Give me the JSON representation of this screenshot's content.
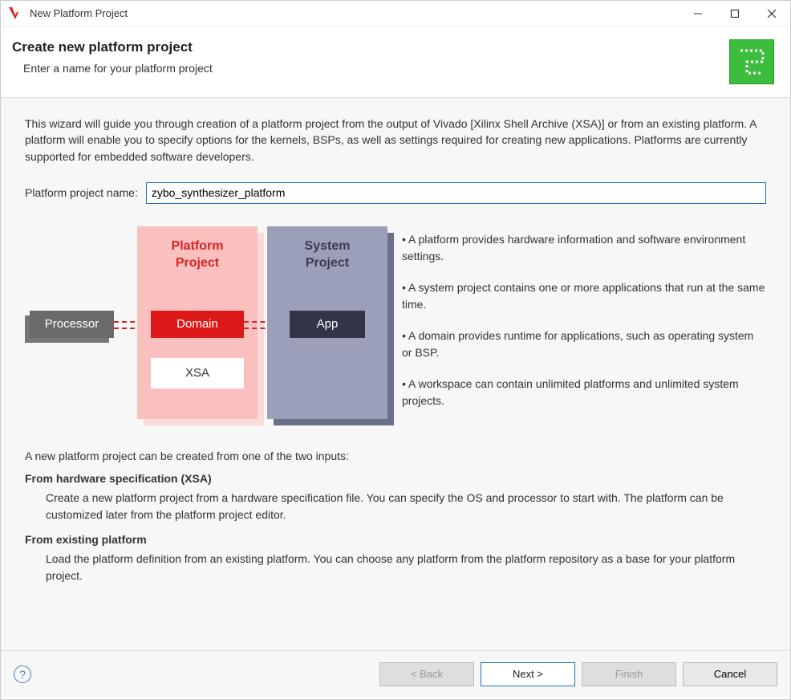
{
  "window": {
    "title": "New Platform Project"
  },
  "header": {
    "heading": "Create new platform project",
    "sub": "Enter a name for your platform project"
  },
  "intro": "This wizard will guide you through creation of a platform project from the output of Vivado [Xilinx Shell Archive (XSA)] or from an existing platform. A platform will enable you to specify options for the kernels, BSPs, as well as settings required for creating new applications. Platforms are currently supported for embedded software developers.",
  "form": {
    "name_label": "Platform project name:",
    "name_value": "zybo_synthesizer_platform"
  },
  "diagram": {
    "processor": "Processor",
    "platform_title_l1": "Platform",
    "platform_title_l2": "Project",
    "domain": "Domain",
    "xsa": "XSA",
    "system_title_l1": "System",
    "system_title_l2": "Project",
    "app": "App"
  },
  "bullets": {
    "b1": "• A platform provides hardware information and software environment settings.",
    "b2": "• A system project contains one or more applications that run at the same time.",
    "b3": "• A domain provides runtime for applications, such as operating system or BSP.",
    "b4": "• A workspace can contain unlimited platforms and unlimited system projects."
  },
  "desc": {
    "lead": "A new platform project can be created from one of the two inputs:",
    "h1": "From hardware specification (XSA)",
    "p1": "Create a new platform project from a hardware specification file. You can specify the OS and processor to start with. The platform can be customized later from the platform project editor.",
    "h2": "From existing platform",
    "p2": "Load the platform definition from an existing platform. You can choose any platform from the platform repository as a base for your platform project."
  },
  "buttons": {
    "back": "< Back",
    "next": "Next >",
    "finish": "Finish",
    "cancel": "Cancel",
    "help": "?"
  }
}
